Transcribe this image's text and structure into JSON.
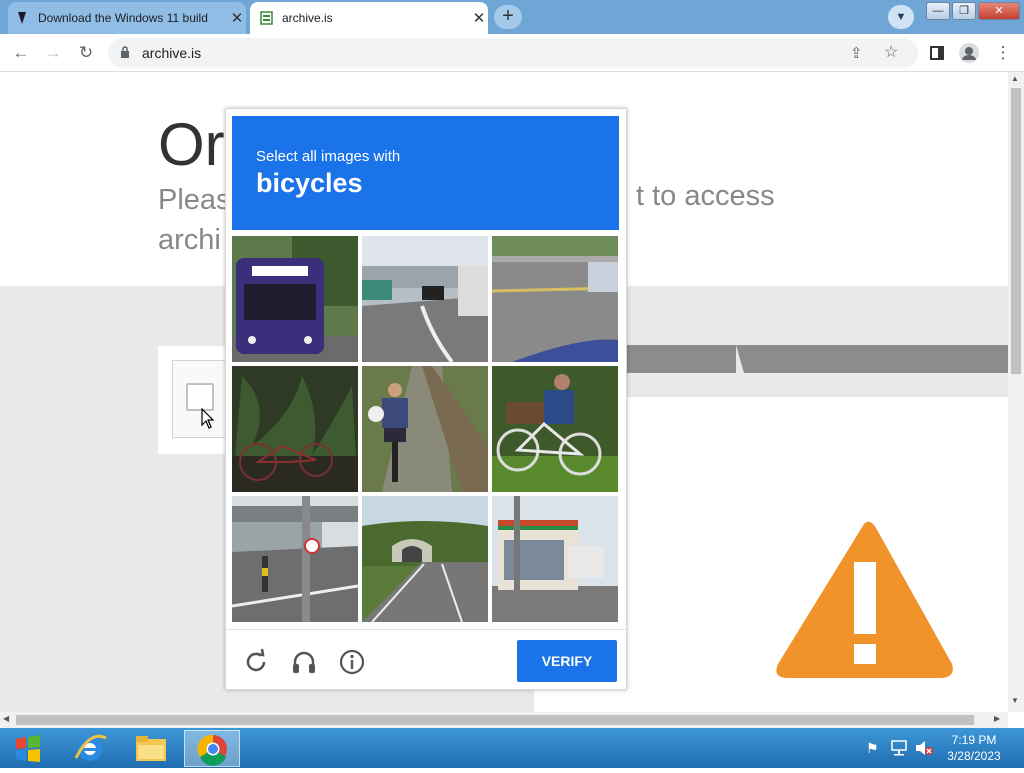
{
  "browser": {
    "tabs": [
      {
        "title": "Download the Windows 11 build"
      },
      {
        "title": "archive.is"
      }
    ],
    "address": "archive.is"
  },
  "page": {
    "heading": "Or",
    "text_line1": "Pleas",
    "text_tail": "t to access",
    "text_line2": "archi"
  },
  "captcha": {
    "instruction": "Select all images with",
    "object": "bicycles",
    "verify_label": "VERIFY",
    "tiles": [
      "bus",
      "street-crosswalk",
      "road-car",
      "bicycle-in-plants",
      "cyclist-on-path",
      "parked-bicycle",
      "traffic-pole",
      "tunnel-road",
      "convenience-store"
    ]
  },
  "taskbar": {
    "time": "7:19 PM",
    "date": "3/28/2023"
  },
  "colors": {
    "captcha_blue": "#1a73e8",
    "warning_orange": "#f0932b"
  }
}
